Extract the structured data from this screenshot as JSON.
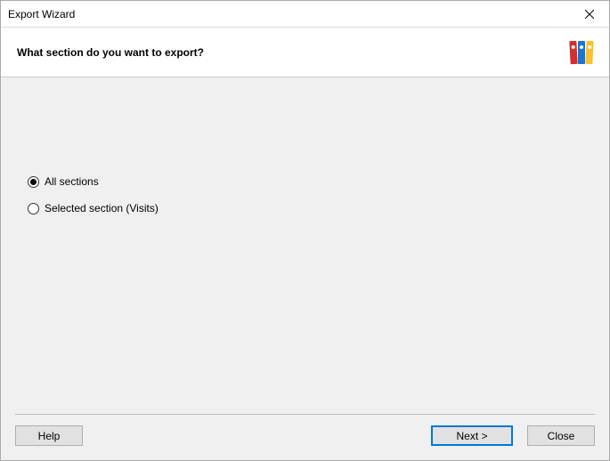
{
  "titlebar": {
    "title": "Export Wizard"
  },
  "header": {
    "question": "What section do you want to export?"
  },
  "options": {
    "all_sections": "All sections",
    "selected_section": "Selected section (Visits)",
    "selected": "all_sections"
  },
  "footer": {
    "help": "Help",
    "next": "Next >",
    "close": "Close"
  }
}
